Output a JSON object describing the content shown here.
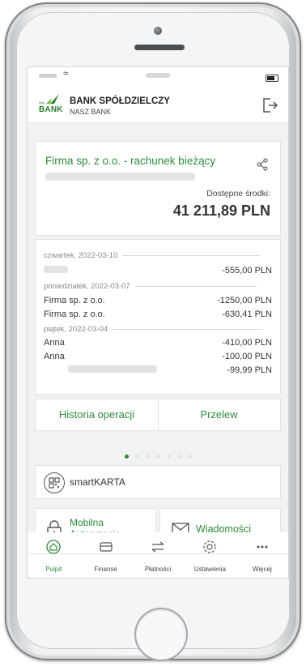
{
  "header": {
    "bank_name": "BANK SPÓŁDZIELCZY",
    "bank_sub": "NASZ BANK",
    "logo_text": "BANK",
    "logo_small": "twój"
  },
  "account": {
    "name": "Firma sp. z o.o. - rachunek bieżący",
    "available_label": "Dostępne środki:",
    "available_amount": "41 211,89 PLN"
  },
  "transactions": {
    "groups": [
      {
        "date": "czwartek, 2022-03-10",
        "rows": [
          {
            "name": "",
            "amount": "-555,00 PLN"
          }
        ]
      },
      {
        "date": "poniedziałek, 2022-03-07",
        "rows": [
          {
            "name": "Firma sp. z o.o.",
            "amount": "-1250,00 PLN"
          },
          {
            "name": "Firma sp. z o.o.",
            "amount": "-630,41 PLN"
          }
        ]
      },
      {
        "date": "piątek, 2022-03-04",
        "rows": [
          {
            "name": "Anna",
            "amount": "-410,00 PLN"
          },
          {
            "name": "Anna",
            "amount": "-100,00 PLN"
          },
          {
            "name": "",
            "amount": "-99,99 PLN"
          }
        ]
      }
    ]
  },
  "actions": {
    "history": "Historia operacji",
    "transfer": "Przelew"
  },
  "smartkarta": {
    "label": "smartKARTA"
  },
  "mobile_auth": {
    "label_line1": "Mobilna",
    "label_line2": "Autoryzacja"
  },
  "messages": {
    "label": "Wiadomości"
  },
  "tabs": [
    {
      "label": "Pulpit",
      "icon": "home-icon",
      "active": true
    },
    {
      "label": "Finanse",
      "icon": "wallet-icon",
      "active": false
    },
    {
      "label": "Płatności",
      "icon": "transfer-arrows-icon",
      "active": false
    },
    {
      "label": "Ustawienia",
      "icon": "gear-icon",
      "active": false
    },
    {
      "label": "Więcej",
      "icon": "more-dots-icon",
      "active": false
    }
  ],
  "colors": {
    "accent": "#2e8b3c",
    "text": "#333333"
  }
}
